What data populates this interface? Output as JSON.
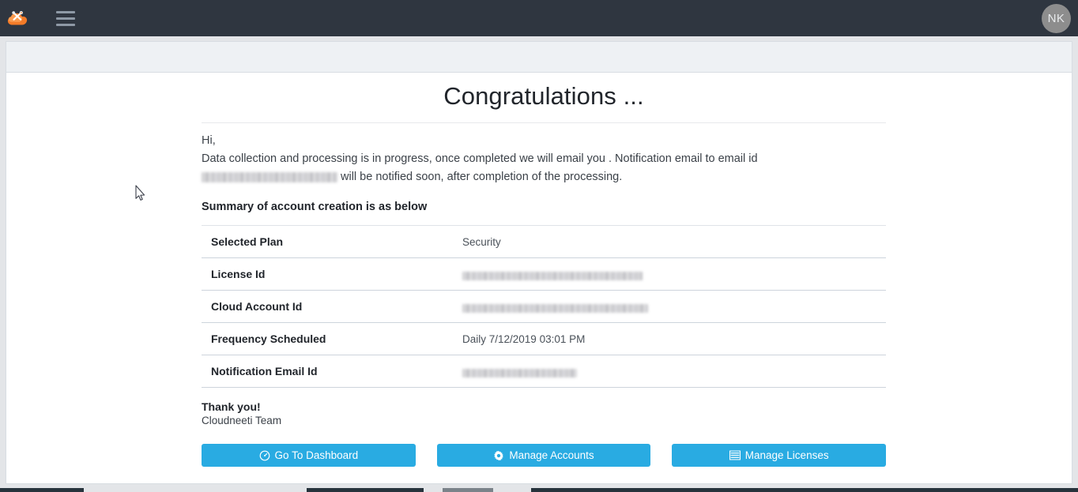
{
  "navbar": {
    "logo_icon": "cloud-tools-logo-icon",
    "menu_icon": "hamburger-menu-icon",
    "avatar_initials": "NK",
    "background_color": "#2f3640"
  },
  "page": {
    "title": "Congratulations ...",
    "greeting": "Hi,",
    "intro_line1": "Data collection and processing is in progress, once completed we will email you . Notification email to email id",
    "intro_email_redacted": "",
    "intro_line2": "will be notified soon, after completion of the processing.",
    "section_title": "Summary of account creation is as below"
  },
  "summary": {
    "rows": [
      {
        "label": "Selected Plan",
        "value": "Security",
        "redacted": false
      },
      {
        "label": "License Id",
        "value": "",
        "redacted": true
      },
      {
        "label": "Cloud Account Id",
        "value": "",
        "redacted": true
      },
      {
        "label": "Frequency Scheduled",
        "value": "Daily 7/12/2019 03:01 PM",
        "redacted": false
      },
      {
        "label": "Notification Email Id",
        "value": "",
        "redacted": true
      }
    ]
  },
  "closing": {
    "thanks": "Thank you!",
    "team": "Cloudneeti Team"
  },
  "actions": {
    "accent_color": "#29abe2",
    "buttons": [
      {
        "label": "Go To Dashboard",
        "icon": "dashboard-gauge-icon"
      },
      {
        "label": "Manage Accounts",
        "icon": "gear-icon"
      },
      {
        "label": "Manage Licenses",
        "icon": "list-table-icon"
      }
    ]
  }
}
